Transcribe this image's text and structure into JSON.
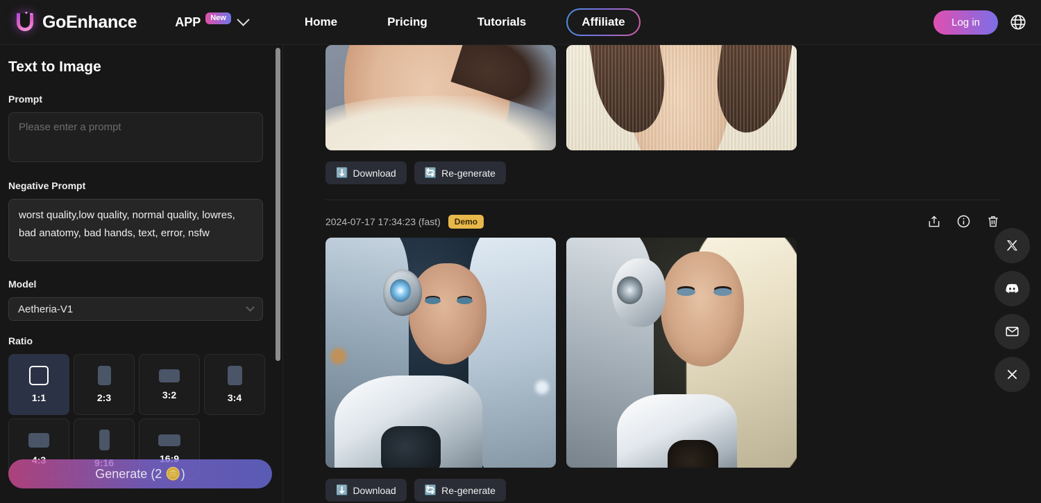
{
  "header": {
    "brand": "GoEnhance",
    "app_menu": {
      "label": "APP",
      "badge": "New",
      "chevron_icon": "chevron-down-icon"
    },
    "nav": [
      {
        "label": "Home"
      },
      {
        "label": "Pricing"
      },
      {
        "label": "Tutorials"
      }
    ],
    "affiliate_label": "Affiliate",
    "login_label": "Log in",
    "language_icon": "globe-icon"
  },
  "sidebar": {
    "title": "Text to Image",
    "prompt": {
      "label": "Prompt",
      "value": "",
      "placeholder": "Please enter a prompt"
    },
    "negative_prompt": {
      "label": "Negative Prompt",
      "value": "worst quality,low quality, normal quality, lowres, bad anatomy, bad hands, text, error, nsfw"
    },
    "model": {
      "label": "Model",
      "selected": "Aetheria-V1",
      "chevron_icon": "chevron-down-icon"
    },
    "ratio": {
      "label": "Ratio",
      "selected": "1:1",
      "options": [
        {
          "label": "1:1",
          "shape_w": 28,
          "shape_h": 28
        },
        {
          "label": "2:3",
          "shape_w": 19,
          "shape_h": 28
        },
        {
          "label": "3:2",
          "shape_w": 30,
          "shape_h": 19
        },
        {
          "label": "3:4",
          "shape_w": 21,
          "shape_h": 28
        },
        {
          "label": "4:3",
          "shape_w": 30,
          "shape_h": 21
        },
        {
          "label": "9:16",
          "shape_w": 15,
          "shape_h": 30
        },
        {
          "label": "16:9",
          "shape_w": 32,
          "shape_h": 17
        }
      ]
    },
    "generate_label": "Generate (2 🪙)",
    "scrollbar": "sidebar-scrollbar"
  },
  "main": {
    "results": [
      {
        "id": "result-top",
        "timestamp": "",
        "badge": "",
        "images": [
          {
            "alt": "close-up of woman neck and white lace top",
            "style": "neck1"
          },
          {
            "alt": "close-up of woman in cream knit cardigan",
            "style": "neck2"
          }
        ],
        "actions": [
          {
            "icon": "download-icon",
            "glyph": "⬇️",
            "label": "Download"
          },
          {
            "icon": "regenerate-icon",
            "glyph": "🔄",
            "label": "Re-generate"
          }
        ]
      },
      {
        "id": "result-cyborg",
        "timestamp": "2024-07-17 17:34:23 (fast)",
        "badge": "Demo",
        "meta_icons": [
          {
            "name": "share-icon"
          },
          {
            "name": "info-icon"
          },
          {
            "name": "delete-icon"
          }
        ],
        "images": [
          {
            "alt": "cyborg woman with silver hair and headset",
            "style": "cy1"
          },
          {
            "alt": "cyborg woman with flowing blonde silver hair",
            "style": "cy2"
          }
        ],
        "actions": [
          {
            "icon": "download-icon",
            "glyph": "⬇️",
            "label": "Download"
          },
          {
            "icon": "regenerate-icon",
            "glyph": "🔄",
            "label": "Re-generate"
          }
        ]
      }
    ]
  },
  "social_rail": [
    {
      "name": "twitter-x-icon",
      "title": "X"
    },
    {
      "name": "discord-icon",
      "title": "Discord"
    },
    {
      "name": "email-icon",
      "title": "Email"
    },
    {
      "name": "close-icon",
      "title": "Close"
    }
  ],
  "colors": {
    "page_bg": "#171717",
    "panel_bg": "#191919",
    "accent_pink": "#e04fb0",
    "accent_blue": "#7c6ee8",
    "badge_amber": "#e8b84b",
    "selected_tile": "#2b3245"
  }
}
